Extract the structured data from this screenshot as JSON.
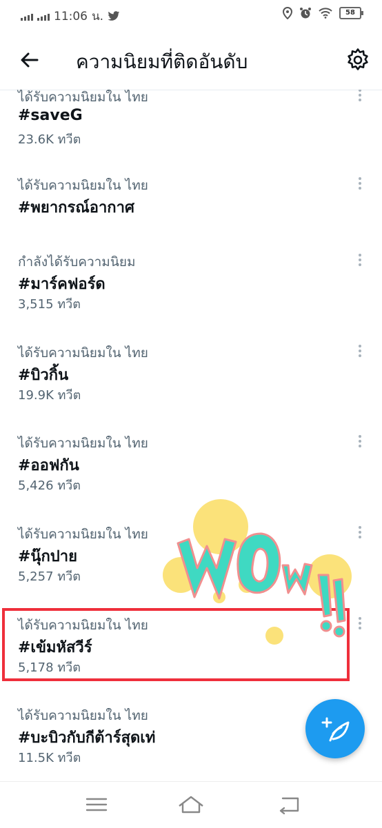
{
  "status_bar": {
    "time": "11:06",
    "carrier_suffix": "น.",
    "battery": "58",
    "left_icons": [
      "signal-icon",
      "signal-icon",
      "twitter-icon"
    ],
    "right_icons": [
      "location-icon",
      "alarm-icon",
      "wifi-icon",
      "battery-icon"
    ]
  },
  "header": {
    "title": "ความนิยมที่ติดอันดับ",
    "back_icon": "arrow-left-icon",
    "settings_icon": "gear-icon"
  },
  "trends": [
    {
      "context": "ได้รับความนิยมใน ไทย",
      "name": "#saveG",
      "count": "23.6K ทวีต"
    },
    {
      "context": "ได้รับความนิยมใน ไทย",
      "name": "#พยากรณ์อากาศ",
      "count": ""
    },
    {
      "context": "กำลังได้รับความนิยม",
      "name": "#มาร์คฟอร์ด",
      "count": "3,515 ทวีต"
    },
    {
      "context": "ได้รับความนิยมใน ไทย",
      "name": "#บิวกิ้น",
      "count": "19.9K ทวีต"
    },
    {
      "context": "ได้รับความนิยมใน ไทย",
      "name": "#ออฟกัน",
      "count": "5,426 ทวีต"
    },
    {
      "context": "ได้รับความนิยมใน ไทย",
      "name": "#นุ๊กปาย",
      "count": "5,257 ทวีต"
    },
    {
      "context": "ได้รับความนิยมใน ไทย",
      "name": "#เข้มหัสวีร์",
      "count": "5,178 ทวีต"
    },
    {
      "context": "ได้รับความนิยมใน ไทย",
      "name": "#บะบิวกับกีต้าร์สุดเท่",
      "count": "11.5K ทวีต"
    }
  ],
  "sticker": {
    "text": "WOw!!",
    "colors": {
      "fill": "#3fd9c2",
      "outline": "#f08f8f",
      "dots": "#fbe27a"
    }
  },
  "fab": {
    "icon": "compose-tweet-icon",
    "color": "#1d9bf0"
  },
  "nav_bar": {
    "icons": [
      "menu-icon",
      "home-icon",
      "back-icon"
    ]
  },
  "colors": {
    "accent": "#1d9bf0",
    "highlight": "#ef2f3b",
    "secondary_text": "#536471"
  }
}
